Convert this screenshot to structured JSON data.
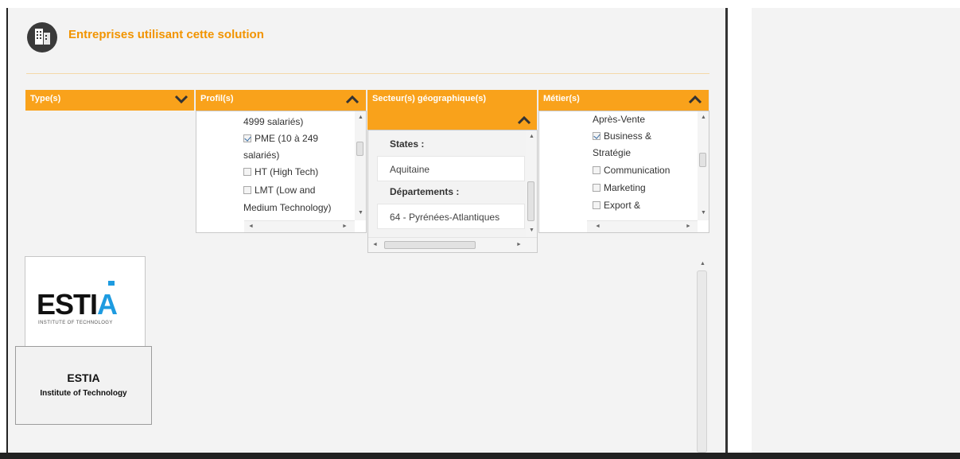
{
  "header": {
    "title": "Entreprises utilisant cette solution",
    "icon": "buildings-icon",
    "accent_color": "#f29400"
  },
  "filters": {
    "type": {
      "label": "Type(s)",
      "state": "collapsed"
    },
    "profil": {
      "label": "Profil(s)",
      "state": "expanded",
      "lines": [
        {
          "text": "4999 salariés)",
          "checkbox": false
        },
        {
          "text": "PME (10 à 249",
          "checkbox": true,
          "checked": true
        },
        {
          "text": "salariés)",
          "checkbox": false
        },
        {
          "text": "HT (High Tech)",
          "checkbox": true,
          "checked": false
        },
        {
          "text": "LMT (Low and",
          "checkbox": true,
          "checked": false
        },
        {
          "text": "Medium Technology)",
          "checkbox": false
        }
      ]
    },
    "secteur": {
      "label": "Secteur(s) géographique(s)",
      "state": "expanded",
      "states_label": "States :",
      "state_value": "Aquitaine",
      "departements_label": "Départements :",
      "departement_value": "64 - Pyrénées-Atlantiques"
    },
    "metier": {
      "label": "Métier(s)",
      "state": "expanded",
      "lines": [
        {
          "text": "Après-Vente",
          "checkbox": false
        },
        {
          "text": "Business &",
          "checkbox": true,
          "checked": true
        },
        {
          "text": "Stratégie",
          "checkbox": false
        },
        {
          "text": "Communication",
          "checkbox": true,
          "checked": false
        },
        {
          "text": "Marketing",
          "checkbox": true,
          "checked": false
        },
        {
          "text": "Export &",
          "checkbox": true,
          "checked": false
        }
      ]
    }
  },
  "results": [
    {
      "logo_text": "ESTIA",
      "logo_tagline": "INSTITUTE OF TECHNOLOGY",
      "name": "ESTIA",
      "subtitle": "Institute of Technology"
    }
  ],
  "colors": {
    "filter_header": "#f9a21b",
    "logo_dark": "#111111",
    "logo_blue": "#1e9be0"
  }
}
